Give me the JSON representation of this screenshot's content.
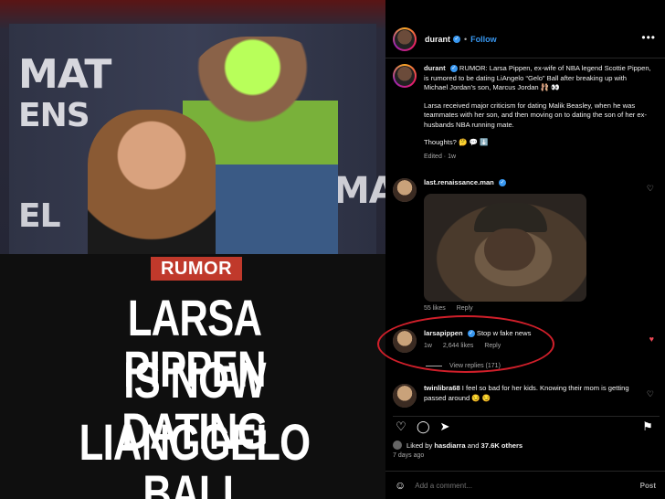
{
  "image": {
    "backdrop_words": [
      "MAT",
      "ENS",
      "EL",
      "MA"
    ],
    "badge": "RUMOR",
    "headline_lines": [
      "LARSA PIPPEN",
      "IS NOW DATING",
      "LIANGGELO BALL"
    ]
  },
  "post": {
    "author": "durant",
    "follow_label": "Follow",
    "caption_lead": "RUMOR: Larsa Pippen, ex-wife of NBA legend Scottie Pippen, is rumored to be dating LiAngelo “Gelo” Ball after breaking up with Michael Jordan’s son, Marcus Jordan 🩰 👀",
    "caption_p2": "Larsa received major criticism for dating Malik Beasley, when he was teammates with her son, and then moving on to dating the son of her ex-husbands NBA running mate.",
    "caption_p3": "Thoughts? 🤔 💬 ⬇️",
    "caption_meta": "Edited · 1w"
  },
  "comments": [
    {
      "user": "last.renaissance.man",
      "text": "",
      "likes": "55 likes",
      "reply": "Reply",
      "time": ""
    },
    {
      "user": "larsapippen",
      "text": "Stop w fake news",
      "time": "1w",
      "likes": "2,644 likes",
      "reply": "Reply"
    },
    {
      "user": "twinlibra68",
      "text": "I feel so bad for her kids. Knowing their mom is getting passed around 😏 😏"
    }
  ],
  "view_replies": "View replies (171)",
  "likes_summary": {
    "prefix": "Liked by",
    "user": "hasdiarra",
    "joiner": "and",
    "others": "37.6K others"
  },
  "time_ago": "7 days ago",
  "add_comment": {
    "placeholder": "Add a comment...",
    "post_label": "Post"
  },
  "icons": {
    "heart": "heart-icon",
    "comment": "comment-icon",
    "share": "share-icon",
    "save": "bookmark-icon",
    "more": "more-icon",
    "emoji": "smile-icon"
  },
  "colors": {
    "accent_blue": "#3897f0",
    "like_red": "#ed4956",
    "badge_red": "#c0392b",
    "highlight_circle": "#d01f2a"
  }
}
